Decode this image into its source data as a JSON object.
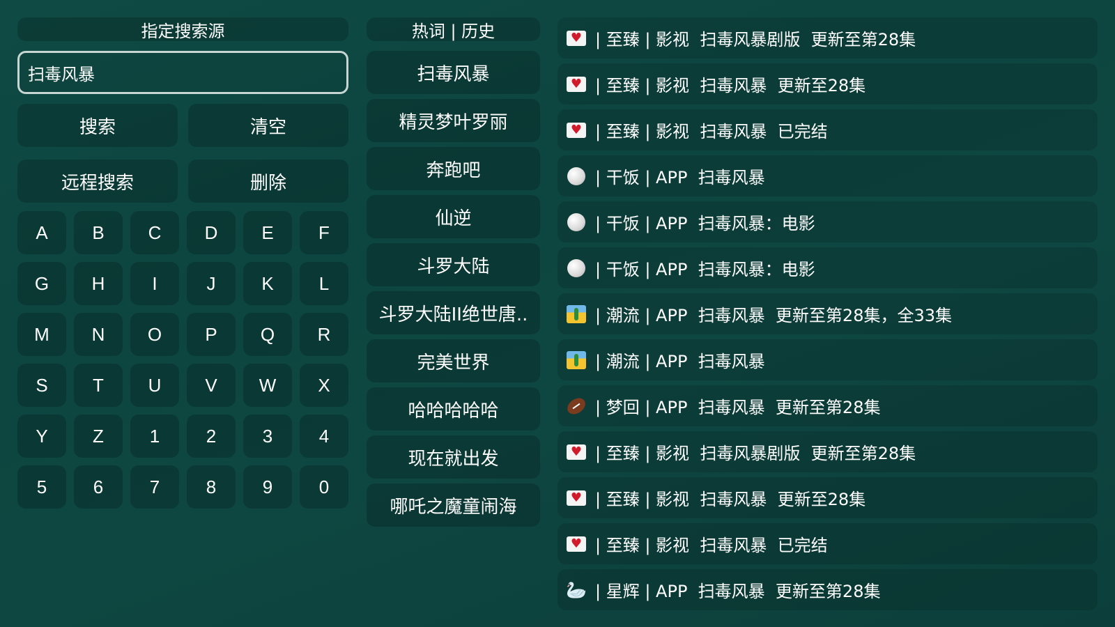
{
  "left": {
    "header": "指定搜索源",
    "search_value": "扫毒风暴",
    "search_button": "搜索",
    "clear_button": "清空",
    "remote_search_button": "远程搜索",
    "delete_button": "删除",
    "keys": [
      "A",
      "B",
      "C",
      "D",
      "E",
      "F",
      "G",
      "H",
      "I",
      "J",
      "K",
      "L",
      "M",
      "N",
      "O",
      "P",
      "Q",
      "R",
      "S",
      "T",
      "U",
      "V",
      "W",
      "X",
      "Y",
      "Z",
      "1",
      "2",
      "3",
      "4",
      "5",
      "6",
      "7",
      "8",
      "9",
      "0"
    ]
  },
  "middle": {
    "header": "热词 | 历史",
    "items": [
      "扫毒风暴",
      "精灵梦叶罗丽",
      "奔跑吧",
      "仙逆",
      "斗罗大陆",
      "斗罗大陆II绝世唐..",
      "完美世界",
      "哈哈哈哈哈",
      "现在就出发",
      "哪吒之魔童闹海"
    ]
  },
  "results": [
    {
      "icon": "heart-icon",
      "text": "| 至臻 | 影视  扫毒风暴剧版  更新至第28集"
    },
    {
      "icon": "heart-icon",
      "text": "| 至臻 | 影视  扫毒风暴  更新至28集"
    },
    {
      "icon": "heart-icon",
      "text": "| 至臻 | 影视  扫毒风暴  已完结"
    },
    {
      "icon": "ball-icon",
      "text": "| 干饭 | APP  扫毒风暴"
    },
    {
      "icon": "ball-icon",
      "text": "| 干饭 | APP  扫毒风暴：电影"
    },
    {
      "icon": "ball-icon",
      "text": "| 干饭 | APP  扫毒风暴：电影"
    },
    {
      "icon": "cactus-icon",
      "text": "| 潮流 | APP  扫毒风暴  更新至第28集，全33集"
    },
    {
      "icon": "cactus-icon",
      "text": "| 潮流 | APP  扫毒风暴"
    },
    {
      "icon": "football-icon",
      "text": "| 梦回 | APP  扫毒风暴  更新至第28集"
    },
    {
      "icon": "heart-icon",
      "text": "| 至臻 | 影视  扫毒风暴剧版  更新至第28集"
    },
    {
      "icon": "heart-icon",
      "text": "| 至臻 | 影视  扫毒风暴  更新至28集"
    },
    {
      "icon": "heart-icon",
      "text": "| 至臻 | 影视  扫毒风暴  已完结"
    },
    {
      "icon": "swan-icon",
      "text": "| 星辉 | APP  扫毒风暴  更新至第28集"
    }
  ]
}
